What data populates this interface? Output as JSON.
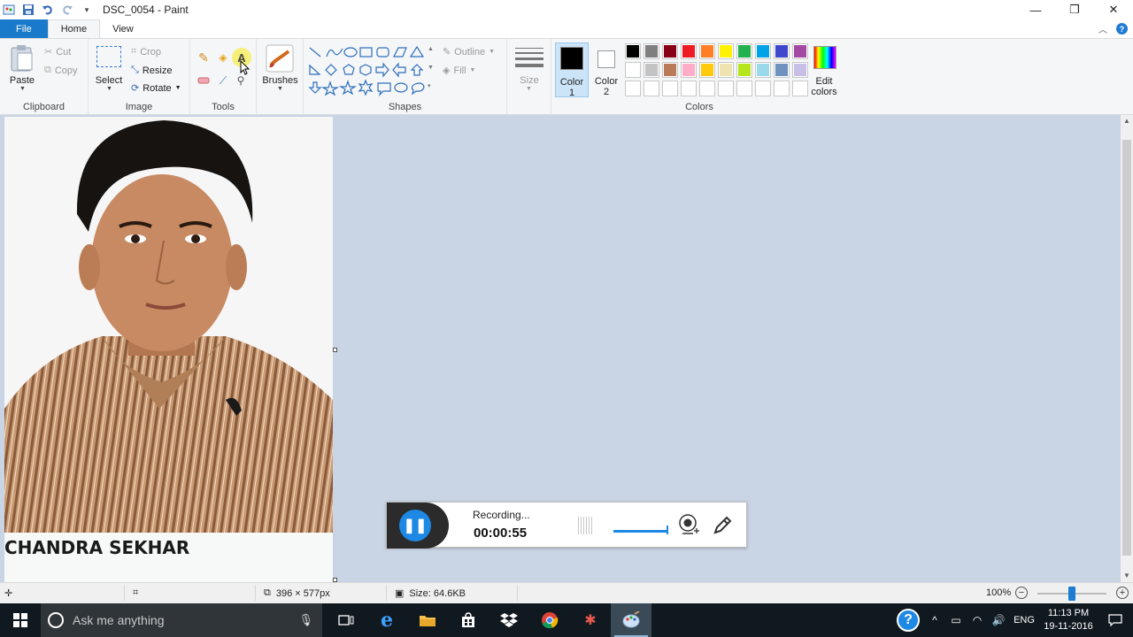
{
  "window": {
    "title": "DSC_0054 - Paint",
    "controls": {
      "minimize": "—",
      "restore": "❐",
      "close": "✕"
    }
  },
  "tabs": [
    {
      "label": "File"
    },
    {
      "label": "Home"
    },
    {
      "label": "View"
    }
  ],
  "ribbon": {
    "clipboard": {
      "group": "Clipboard",
      "paste": "Paste",
      "cut": "Cut",
      "copy": "Copy"
    },
    "image": {
      "group": "Image",
      "select": "Select",
      "crop": "Crop",
      "resize": "Resize",
      "rotate": "Rotate"
    },
    "tools": {
      "group": "Tools"
    },
    "brushes": {
      "label": "Brushes"
    },
    "shapes": {
      "group": "Shapes",
      "outline": "Outline",
      "fill": "Fill"
    },
    "size": {
      "label": "Size"
    },
    "colors": {
      "group": "Colors",
      "color1": "Color 1",
      "color1_a": "Color",
      "color1_b": "1",
      "color2_a": "Color",
      "color2_b": "2",
      "edit_a": "Edit",
      "edit_b": "colors",
      "color1_value": "#000000",
      "color2_value": "#ffffff",
      "palette_row1": [
        "#000000",
        "#7f7f7f",
        "#880015",
        "#ed1c24",
        "#ff7f27",
        "#fff200",
        "#22b14c",
        "#00a2e8",
        "#3f48cc",
        "#a349a4"
      ],
      "palette_row2": [
        "#ffffff",
        "#c3c3c3",
        "#b97a57",
        "#ffaec9",
        "#ffc90e",
        "#efe4b0",
        "#b5e61d",
        "#99d9ea",
        "#7092be",
        "#c8bfe7"
      ],
      "palette_row3": [
        "#ffffff",
        "#ffffff",
        "#ffffff",
        "#ffffff",
        "#ffffff",
        "#ffffff",
        "#ffffff",
        "#ffffff",
        "#ffffff",
        "#ffffff"
      ]
    }
  },
  "canvas": {
    "caption": "CHANDRA SEKHAR"
  },
  "recorder": {
    "status": "Recording...",
    "time": "00:00:55"
  },
  "statusbar": {
    "dimensions": "396 × 577px",
    "size": "Size: 64.6KB",
    "zoom": "100%",
    "zoom_level": 1.0
  },
  "taskbar": {
    "search_placeholder": "Ask me anything",
    "tray_lang": "ENG",
    "clock_time": "11:13 PM",
    "clock_date": "19-11-2016"
  }
}
